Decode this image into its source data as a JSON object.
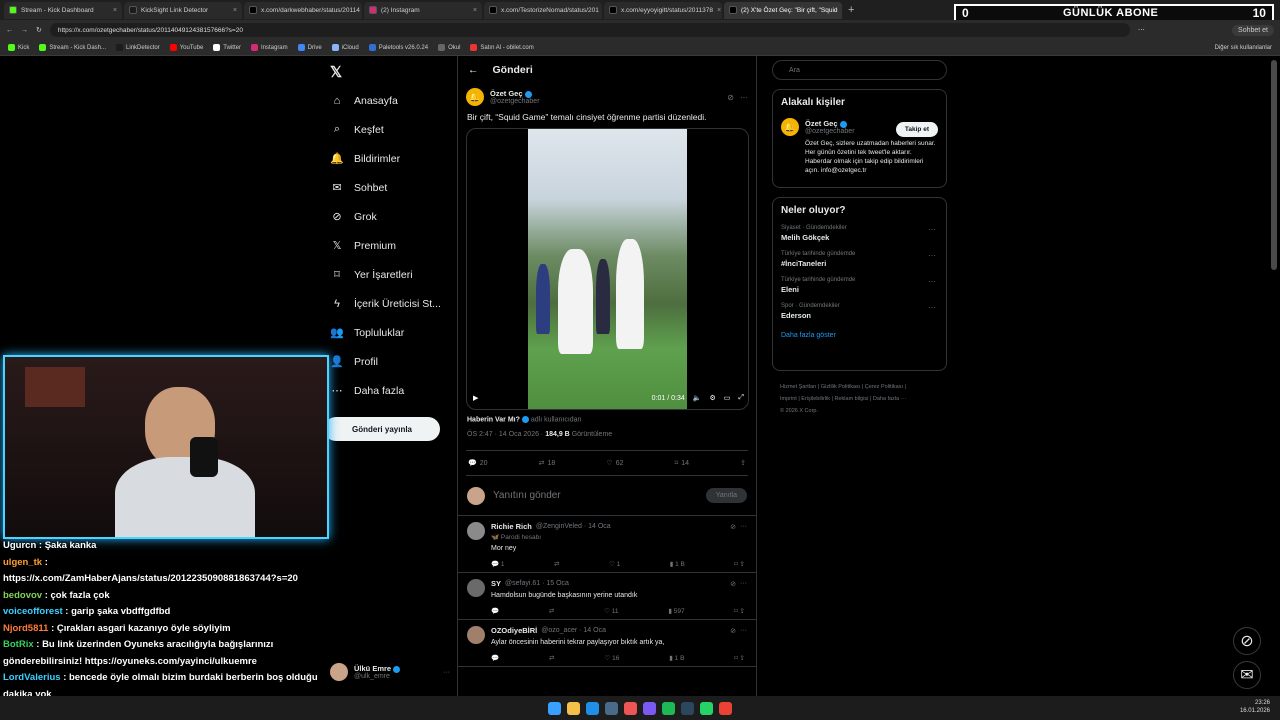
{
  "browser": {
    "tabs": [
      {
        "title": "Stream - Kick Dashboard",
        "color": "#53fc18"
      },
      {
        "title": "KickSight Link Detector",
        "color": "#1c1c1c"
      },
      {
        "title": "x.com/darkwebhaber/status/20114",
        "color": "#000000"
      },
      {
        "title": "(2) Instagram",
        "color": "#d62976"
      },
      {
        "title": "x.com/TestorizeNomad/status/201",
        "color": "#000000"
      },
      {
        "title": "x.com/eyyoyigitt/status/2011378",
        "color": "#000000"
      },
      {
        "title": "(2) X'te Özet Geç: \"Bir çift, \"Squid",
        "color": "#000000"
      }
    ],
    "url": "https://x.com/ozetgechaber/status/2011404912438157666?s=20",
    "bookmarks": [
      "Kick",
      "Stream - Kick Dash...",
      "LinkDetector",
      "YouTube",
      "Twitter",
      "Instagram",
      "Drive",
      "iCloud",
      "Paletools v26.0.24",
      "Okul",
      "Satın Al - obilet.com"
    ],
    "other_bookmarks": "Diğer sık kullanılanlar",
    "chat_button": "Sohbet et"
  },
  "overlay": {
    "left": "0",
    "label": "GÜNLÜK ABONE",
    "right": "10"
  },
  "nav": {
    "items": [
      {
        "label": "Anasayfa",
        "icon": "home-icon"
      },
      {
        "label": "Keşfet",
        "icon": "search-icon"
      },
      {
        "label": "Bildirimler",
        "icon": "bell-icon"
      },
      {
        "label": "Sohbet",
        "icon": "mail-icon"
      },
      {
        "label": "Grok",
        "icon": "grok-icon"
      },
      {
        "label": "Premium",
        "icon": "x-icon"
      },
      {
        "label": "Yer İşaretleri",
        "icon": "bookmark-icon"
      },
      {
        "label": "İçerik Üreticisi St...",
        "icon": "lightning-icon"
      },
      {
        "label": "Topluluklar",
        "icon": "people-icon"
      },
      {
        "label": "Profil",
        "icon": "person-icon"
      },
      {
        "label": "Daha fazla",
        "icon": "more-icon"
      }
    ],
    "post_button": "Gönderi yayınla",
    "account": {
      "name": "Ülkü Emre",
      "handle": "@ulk_emre"
    }
  },
  "main": {
    "header": "Gönderi",
    "tweet": {
      "name": "Özet Geç",
      "handle": "@ozetgechaber",
      "text": "Bir çift, “Squid Game” temalı cinsiyet öğrenme partisi düzenledi.",
      "video_time": "0:01 / 0:34",
      "source_name": "Haberin Var Mı?",
      "source_suffix": "adlı kullanıcıdan",
      "time": "ÖS 2:47 · 14 Oca 2026 ·",
      "views": "184,9 B",
      "views_label": "Görüntüleme",
      "stats": {
        "replies": "20",
        "reposts": "18",
        "likes": "62",
        "bookmarks": "14"
      }
    },
    "reply_placeholder": "Yanıtını gönder",
    "reply_button": "Yanıtla",
    "replies": [
      {
        "name": "Richie Rich",
        "handle": "@ZenginVeled · 14 Oca",
        "sub": "🦋 Parodi hesabı",
        "text": "Mor ney",
        "r": "1",
        "rt": "",
        "l": "1",
        "v": "1 B",
        "avatar": "#8a8a8a"
      },
      {
        "name": "SY",
        "handle": "@sefayi.61 · 15 Oca",
        "sub": "",
        "text": "Hamdolsun bugünde başkasının yerine utandık",
        "r": "",
        "rt": "",
        "l": "11",
        "v": "597",
        "avatar": "#6a6a6a"
      },
      {
        "name": "OZOdiyeBİRİ",
        "handle": "@ozo_acer · 14 Oca",
        "sub": "",
        "text": "Aylar öncesinin haberini tekrar paylaşıyor bıktık artık ya,",
        "r": "",
        "rt": "",
        "l": "16",
        "v": "1 B",
        "avatar": "#a0806a"
      }
    ]
  },
  "right": {
    "search_placeholder": "Ara",
    "related": {
      "title": "Alakalı kişiler",
      "name": "Özet Geç",
      "handle": "@ozetgechaber",
      "follow": "Takip et",
      "bio": "Özet Geç, sizlere uzatmadan haberleri sunar. Her günün özetini tek tweet'le aktarır. Haberdar olmak için takip edip bildirimleri açın. info@ozetgec.tr"
    },
    "trends": {
      "title": "Neler oluyor?",
      "items": [
        {
          "cat": "Siyaset · Gündemdekiler",
          "topic": "Melih Gökçek"
        },
        {
          "cat": "Türkiye tarihinde gündemde",
          "topic": "#İnciTaneleri"
        },
        {
          "cat": "Türkiye tarihinde gündemde",
          "topic": "Eleni"
        },
        {
          "cat": "Spor · Gündemdekiler",
          "topic": "Ederson"
        }
      ],
      "more": "Daha fazla göster"
    },
    "footer_line1": "Hizmet Şartları | Gizlilik Politikası | Çerez Politikası |",
    "footer_line2": "Imprint | Erişilebilirlik | Reklam bilgisi | Daha fazla ···",
    "footer_line3": "© 2026 X Corp."
  },
  "chat": [
    {
      "user": "Ugurcn",
      "text": ": Şaka kanka",
      "color": "#ffffff"
    },
    {
      "user": "ulgen_tk",
      "text": ":",
      "color": "#ff9f2e"
    },
    {
      "user": "",
      "text": "https://x.com/ZamHaberAjans/status/2012235090881863744?s=20",
      "color": "#ffffff"
    },
    {
      "user": "bedovov",
      "text": ": çok fazla çok",
      "color": "#7fd35b"
    },
    {
      "user": "voiceofforest",
      "text": ": garip şaka vbdffgdfbd",
      "color": "#3ad1ff"
    },
    {
      "user": "Njord5811",
      "text": ": Çırakları asgari kazanıyo öyle söyliyim",
      "color": "#ff7b3a"
    },
    {
      "user": "BotRix",
      "text": ": Bu link üzerinden Oyuneks aracılığıyla bağışlarınızı gönderebilirsiniz! https://oyuneks.com/yayinci/ulkuemre",
      "color": "#3ad15b"
    },
    {
      "user": "LordValerius",
      "text": ": bencede öyle olmalı bizim burdaki berberin boş olduğu dakika yok",
      "color": "#3ad1ff"
    }
  ],
  "tray": {
    "time": "23:26",
    "date": "16.01.2026"
  }
}
